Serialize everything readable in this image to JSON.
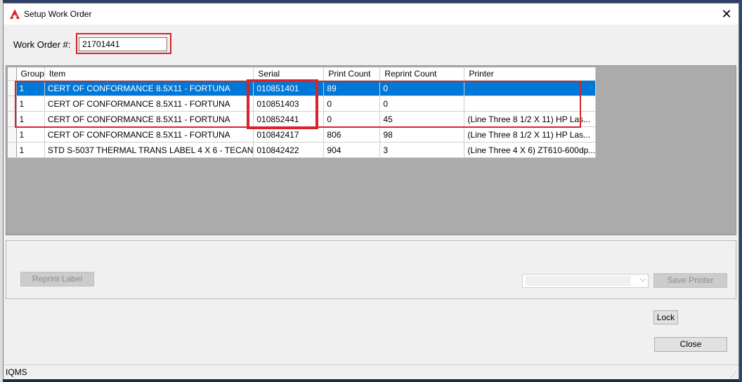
{
  "window": {
    "title": "Setup Work Order",
    "close_glyph": "✕"
  },
  "work_order": {
    "label": "Work Order #:",
    "value": "21701441"
  },
  "grid": {
    "columns": [
      "Group",
      "Item",
      "Serial",
      "Print Count",
      "Reprint Count",
      "Printer"
    ],
    "rows": [
      {
        "group": "1",
        "item": "CERT OF CONFORMANCE 8.5X11 - FORTUNA",
        "serial": "010851401",
        "print_count": "89",
        "reprint_count": "0",
        "printer": ""
      },
      {
        "group": "1",
        "item": "CERT OF CONFORMANCE 8.5X11 - FORTUNA",
        "serial": "010851403",
        "print_count": "0",
        "reprint_count": "0",
        "printer": ""
      },
      {
        "group": "1",
        "item": "CERT OF CONFORMANCE 8.5X11 - FORTUNA",
        "serial": "010852441",
        "print_count": "0",
        "reprint_count": "45",
        "printer": "(Line Three 8 1/2 X 11) HP Las..."
      },
      {
        "group": "1",
        "item": "CERT OF CONFORMANCE 8.5X11 - FORTUNA",
        "serial": "010842417",
        "print_count": "806",
        "reprint_count": "98",
        "printer": "(Line Three 8 1/2 X 11) HP Las..."
      },
      {
        "group": "1",
        "item": "STD S-5037 THERMAL TRANS LABEL 4 X 6 - TECAN",
        "serial": "010842422",
        "print_count": "904",
        "reprint_count": "3",
        "printer": "(Line Three 4 X 6) ZT610-600dp..."
      }
    ]
  },
  "buttons": {
    "reprint_label": "Reprint Label",
    "save_printer": "Save Printer",
    "lock": "Lock",
    "close": "Close"
  },
  "printer_select": {
    "value": "",
    "chevron": "⌵"
  },
  "status": {
    "text": "IQMS"
  },
  "colors": {
    "selection": "#0078d7",
    "highlight": "#d9232a",
    "grid_background": "#ababab"
  },
  "icons": {
    "app": "iqms-logo-icon",
    "close": "close-icon",
    "dropdown": "chevron-down-icon",
    "grip": "resize-grip-icon"
  }
}
